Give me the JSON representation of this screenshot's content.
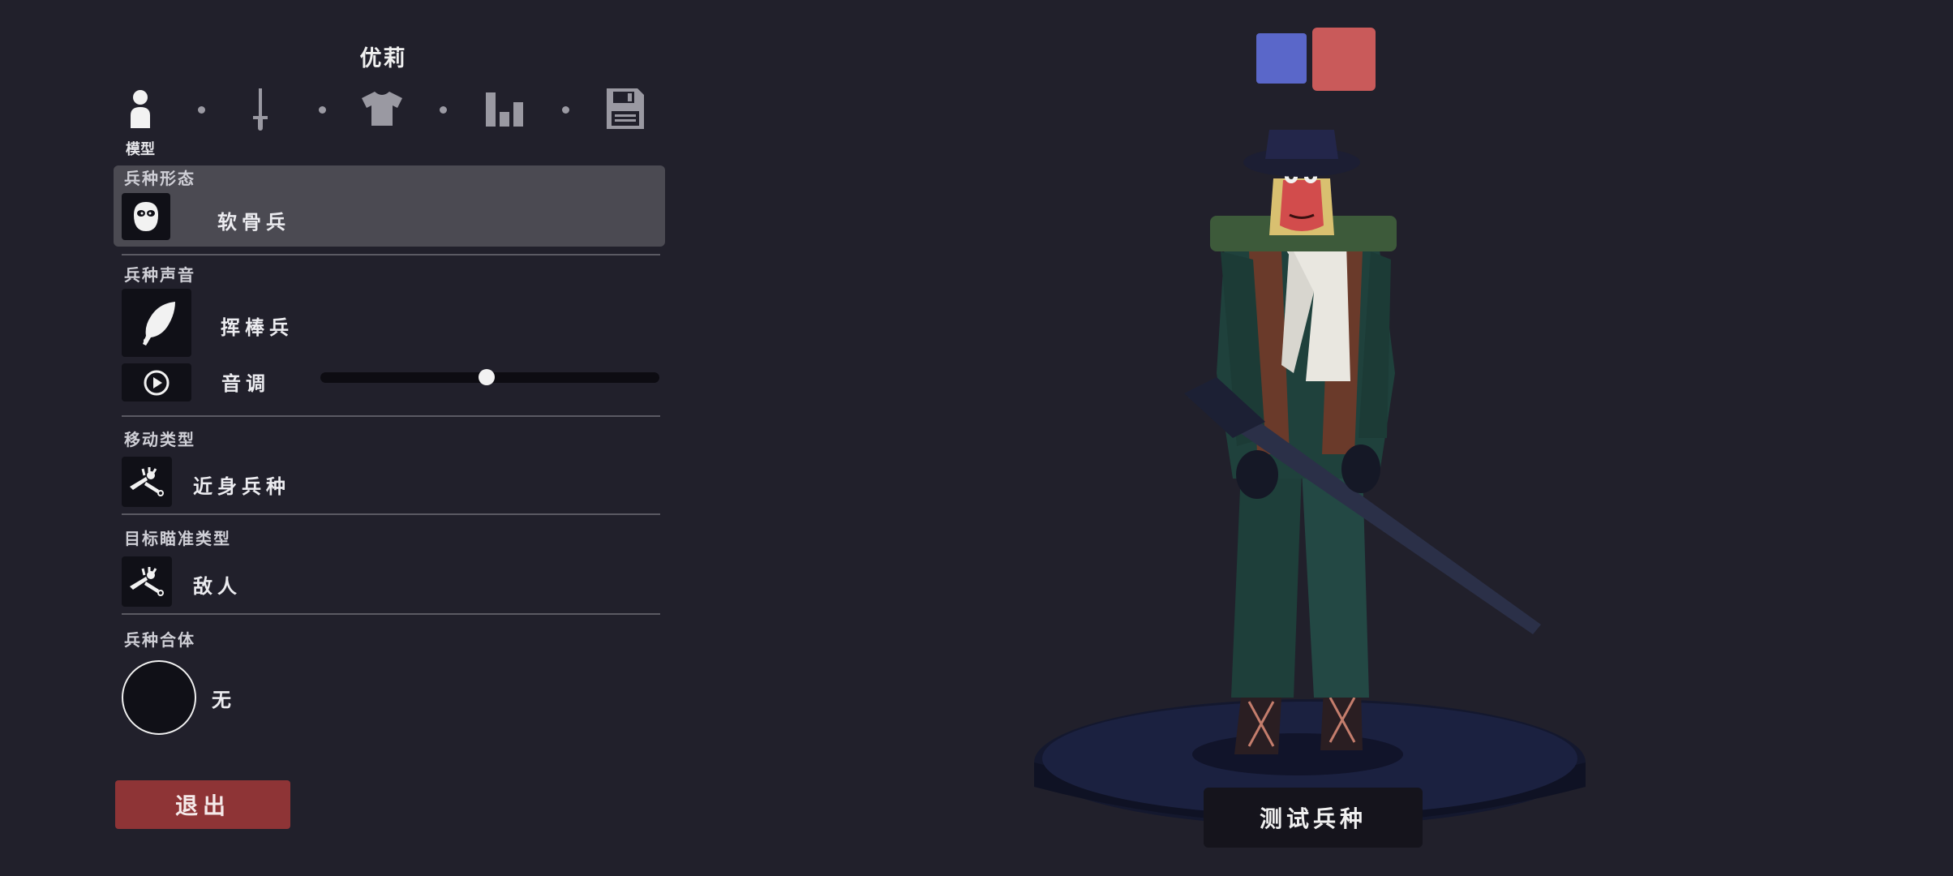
{
  "unit": {
    "name": "优莉"
  },
  "steps": {
    "active_label": "模型",
    "icons": [
      "person-icon",
      "sword-icon",
      "shirt-icon",
      "bar-chart-icon",
      "save-icon"
    ]
  },
  "sections": {
    "form": {
      "title": "兵种形态",
      "value": "软骨兵",
      "icon": "mask-face-icon"
    },
    "voice": {
      "title": "兵种声音",
      "value": "挥棒兵",
      "icon": "feather-icon",
      "pitch_label": "音调",
      "pitch_level": 0.49,
      "play_icon": "play-circle-icon"
    },
    "movement": {
      "title": "移动类型",
      "value": "近身兵种",
      "icon": "lying-figure-icon"
    },
    "targeting": {
      "title": "目标瞄准类型",
      "value": "敌人",
      "icon": "lying-figure-icon"
    },
    "combine": {
      "title": "兵种合体",
      "value": "无"
    }
  },
  "buttons": {
    "exit": "退出",
    "test": "测试兵种"
  },
  "colors": {
    "team_blue": "#5a67c9",
    "team_red": "#c95a5a",
    "exit_red": "#8e3436",
    "background": "#21202b"
  }
}
